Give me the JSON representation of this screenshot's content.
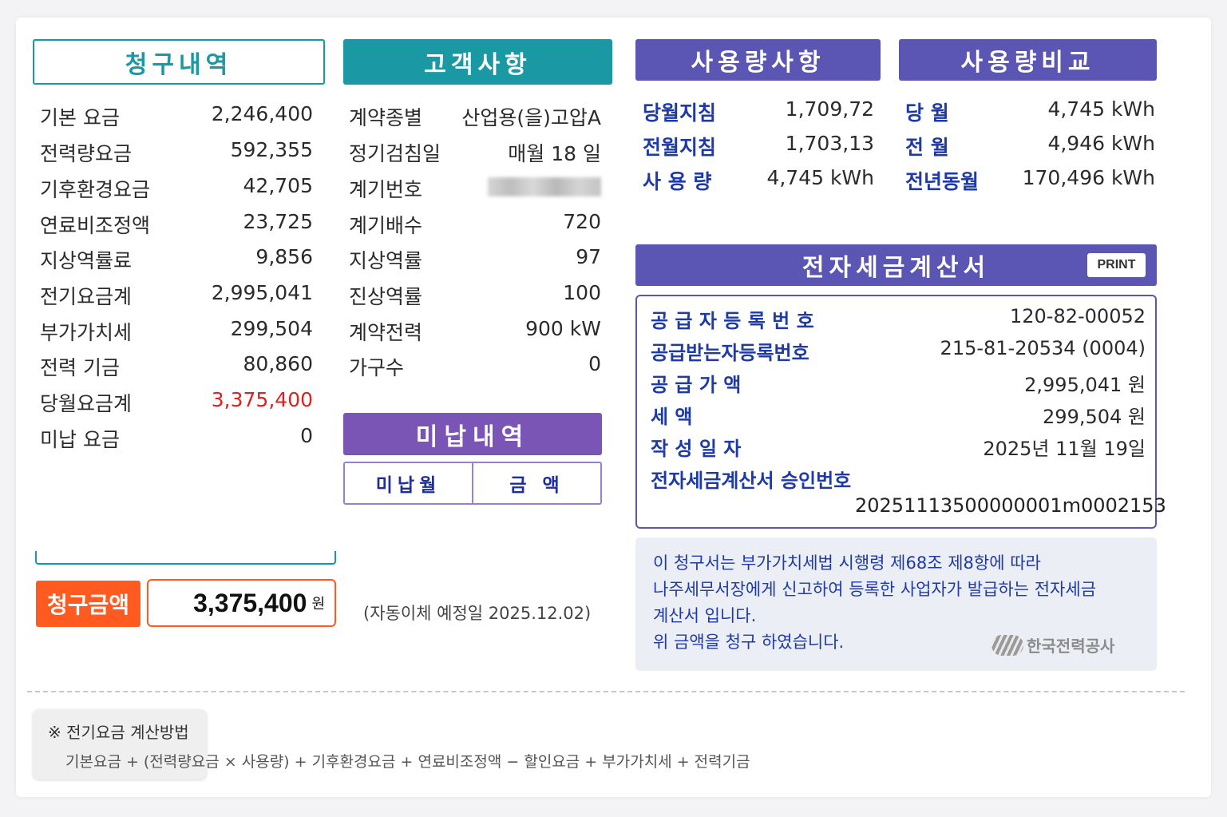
{
  "billing": {
    "title": "청구내역",
    "rows": [
      {
        "label": "기본  요금",
        "value": "2,246,400"
      },
      {
        "label": "전력량요금",
        "value": "592,355"
      },
      {
        "label": "기후환경요금",
        "value": "42,705"
      },
      {
        "label": "연료비조정액",
        "value": "23,725"
      },
      {
        "label": "지상역률료",
        "value": "9,856"
      },
      {
        "label": "전기요금계",
        "value": "2,995,041"
      },
      {
        "label": "부가가치세",
        "value": "299,504"
      },
      {
        "label": "전력  기금",
        "value": "80,860"
      },
      {
        "label": "당월요금계",
        "value": "3,375,400"
      },
      {
        "label": "미납  요금",
        "value": "0"
      }
    ]
  },
  "customer": {
    "title": "고객사항",
    "rows": [
      {
        "label": "계약종별",
        "value": "산업용(을)고압A"
      },
      {
        "label": "정기검침일",
        "value": "매월 18 일"
      },
      {
        "label": "계기번호",
        "value": ""
      },
      {
        "label": "계기배수",
        "value": "720"
      },
      {
        "label": "지상역률",
        "value": "97"
      },
      {
        "label": "진상역률",
        "value": "100"
      },
      {
        "label": "계약전력",
        "value": "900 kW"
      },
      {
        "label": "가구수",
        "value": "0"
      }
    ]
  },
  "unpaid": {
    "title": "미납내역",
    "col_month": "미납월",
    "col_amount": "금  액"
  },
  "charge": {
    "label": "청구금액",
    "amount": "3,375,400",
    "unit": "원",
    "autopay": "(자동이체  예정일  2025.12.02)"
  },
  "usage": {
    "title": "사용량사항",
    "rows": [
      {
        "label": "당월지침",
        "value": "1,709,72"
      },
      {
        "label": "전월지침",
        "value": "1,703,13"
      },
      {
        "label": "사  용  량",
        "value": "4,745 kWh"
      }
    ]
  },
  "compare": {
    "title": "사용량비교",
    "rows": [
      {
        "label": "당      월",
        "value": "4,745 kWh"
      },
      {
        "label": "전      월",
        "value": "4,946 kWh"
      },
      {
        "label": "전년동월",
        "value": "170,496 kWh"
      }
    ]
  },
  "tax_invoice": {
    "title": "전자세금계산서",
    "print_label": "PRINT",
    "rows": [
      {
        "label": "공 급 자 등 록 번 호",
        "value": "120-82-00052"
      },
      {
        "label": "공급받는자등록번호",
        "value": "215-81-20534 (0004)"
      },
      {
        "label": "공      급      가      액",
        "value": "2,995,041  원"
      },
      {
        "label": "세                              액",
        "value": "299,504  원"
      },
      {
        "label": "작      성      일      자",
        "value": "2025년  11월  19일"
      }
    ],
    "approval_label": "전자세금계산서 승인번호",
    "approval_number": "20251113500000001m0002153"
  },
  "notice": {
    "lines": [
      "이 청구서는 부가가치세법 시행령 제68조 제8항에 따라",
      "나주세무서장에게 신고하여 등록한 사업자가 발급하는 전자세금",
      "계산서 입니다.",
      "위 금액을 청구 하였습니다."
    ],
    "company": "한국전력공사"
  },
  "formula": {
    "title": "※ 전기요금 계산방법",
    "text": "기본요금 + (전력량요금 × 사용량) + 기후환경요금 + 연료비조정액 − 할인요금 + 부가가치세 + 전력기금"
  },
  "colors": {
    "teal": "#1a98a3",
    "indigo": "#5b55b4",
    "purple": "#7b55b5",
    "orange": "#ff5a1f",
    "red": "#e02020"
  }
}
